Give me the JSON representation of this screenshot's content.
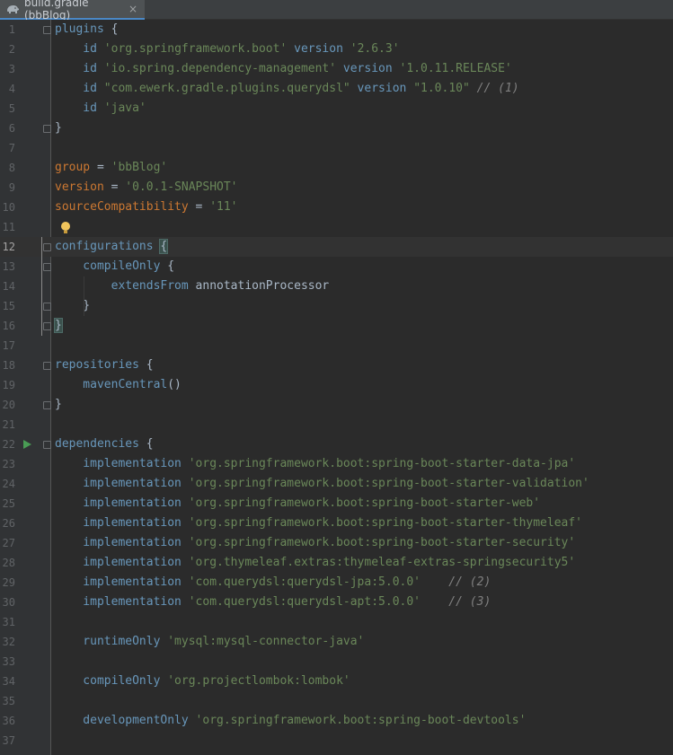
{
  "tab": {
    "title": "build.gradle (bbBlog)",
    "close_glyph": "×",
    "icon": "gradle-elephant-icon"
  },
  "editor": {
    "current_line": 12,
    "lines": [
      {
        "n": "1",
        "tokens": [
          {
            "t": "plugins",
            "c": "meth"
          },
          {
            "t": " {",
            "c": "plain"
          }
        ]
      },
      {
        "n": "2",
        "tokens": [
          {
            "t": "    id ",
            "c": "meth"
          },
          {
            "t": "'org.springframework.boot'",
            "c": "str"
          },
          {
            "t": " version ",
            "c": "meth"
          },
          {
            "t": "'2.6.3'",
            "c": "str"
          }
        ]
      },
      {
        "n": "3",
        "tokens": [
          {
            "t": "    id ",
            "c": "meth"
          },
          {
            "t": "'io.spring.dependency-management'",
            "c": "str"
          },
          {
            "t": " version ",
            "c": "meth"
          },
          {
            "t": "'1.0.11.RELEASE'",
            "c": "str"
          }
        ]
      },
      {
        "n": "4",
        "tokens": [
          {
            "t": "    id ",
            "c": "meth"
          },
          {
            "t": "\"com.ewerk.gradle.plugins.querydsl\"",
            "c": "str"
          },
          {
            "t": " version ",
            "c": "meth"
          },
          {
            "t": "\"1.0.10\"",
            "c": "str"
          },
          {
            "t": " // (1)",
            "c": "cmt"
          }
        ]
      },
      {
        "n": "5",
        "tokens": [
          {
            "t": "    id ",
            "c": "meth"
          },
          {
            "t": "'java'",
            "c": "str"
          }
        ]
      },
      {
        "n": "6",
        "tokens": [
          {
            "t": "}",
            "c": "plain"
          }
        ]
      },
      {
        "n": "7",
        "tokens": []
      },
      {
        "n": "8",
        "tokens": [
          {
            "t": "group",
            "c": "kw"
          },
          {
            "t": " = ",
            "c": "plain"
          },
          {
            "t": "'bbBlog'",
            "c": "str"
          }
        ]
      },
      {
        "n": "9",
        "tokens": [
          {
            "t": "version",
            "c": "kw"
          },
          {
            "t": " = ",
            "c": "plain"
          },
          {
            "t": "'0.0.1-SNAPSHOT'",
            "c": "str"
          }
        ]
      },
      {
        "n": "10",
        "tokens": [
          {
            "t": "sourceCompatibility",
            "c": "kw"
          },
          {
            "t": " = ",
            "c": "plain"
          },
          {
            "t": "'11'",
            "c": "str"
          }
        ]
      },
      {
        "n": "11",
        "tokens": []
      },
      {
        "n": "12",
        "tokens": [
          {
            "t": "configurations",
            "c": "meth"
          },
          {
            "t": " ",
            "c": "plain"
          },
          {
            "t": "{",
            "c": "brace"
          }
        ]
      },
      {
        "n": "13",
        "tokens": [
          {
            "t": "    compileOnly",
            "c": "meth"
          },
          {
            "t": " {",
            "c": "plain"
          }
        ]
      },
      {
        "n": "14",
        "tokens": [
          {
            "t": "        extendsFrom",
            "c": "meth"
          },
          {
            "t": " annotationProcessor",
            "c": "plain"
          }
        ]
      },
      {
        "n": "15",
        "tokens": [
          {
            "t": "    }",
            "c": "plain"
          }
        ]
      },
      {
        "n": "16",
        "tokens": [
          {
            "t": "}",
            "c": "brace"
          }
        ]
      },
      {
        "n": "17",
        "tokens": []
      },
      {
        "n": "18",
        "tokens": [
          {
            "t": "repositories",
            "c": "meth"
          },
          {
            "t": " {",
            "c": "plain"
          }
        ]
      },
      {
        "n": "19",
        "tokens": [
          {
            "t": "    mavenCentral",
            "c": "meth"
          },
          {
            "t": "()",
            "c": "plain"
          }
        ]
      },
      {
        "n": "20",
        "tokens": [
          {
            "t": "}",
            "c": "plain"
          }
        ]
      },
      {
        "n": "21",
        "tokens": []
      },
      {
        "n": "22",
        "tokens": [
          {
            "t": "dependencies",
            "c": "meth"
          },
          {
            "t": " {",
            "c": "plain"
          }
        ]
      },
      {
        "n": "23",
        "tokens": [
          {
            "t": "    implementation ",
            "c": "meth"
          },
          {
            "t": "'org.springframework.boot:spring-boot-starter-data-jpa'",
            "c": "str"
          }
        ]
      },
      {
        "n": "24",
        "tokens": [
          {
            "t": "    implementation ",
            "c": "meth"
          },
          {
            "t": "'org.springframework.boot:spring-boot-starter-validation'",
            "c": "str"
          }
        ]
      },
      {
        "n": "25",
        "tokens": [
          {
            "t": "    implementation ",
            "c": "meth"
          },
          {
            "t": "'org.springframework.boot:spring-boot-starter-web'",
            "c": "str"
          }
        ]
      },
      {
        "n": "26",
        "tokens": [
          {
            "t": "    implementation ",
            "c": "meth"
          },
          {
            "t": "'org.springframework.boot:spring-boot-starter-thymeleaf'",
            "c": "str"
          }
        ]
      },
      {
        "n": "27",
        "tokens": [
          {
            "t": "    implementation ",
            "c": "meth"
          },
          {
            "t": "'org.springframework.boot:spring-boot-starter-security'",
            "c": "str"
          }
        ]
      },
      {
        "n": "28",
        "tokens": [
          {
            "t": "    implementation ",
            "c": "meth"
          },
          {
            "t": "'org.thymeleaf.extras:thymeleaf-extras-springsecurity5'",
            "c": "str"
          }
        ]
      },
      {
        "n": "29",
        "tokens": [
          {
            "t": "    implementation ",
            "c": "meth"
          },
          {
            "t": "'com.querydsl:querydsl-jpa:5.0.0'",
            "c": "str"
          },
          {
            "t": "    // (2)",
            "c": "cmt"
          }
        ]
      },
      {
        "n": "30",
        "tokens": [
          {
            "t": "    implementation ",
            "c": "meth"
          },
          {
            "t": "'com.querydsl:querydsl-apt:5.0.0'",
            "c": "str"
          },
          {
            "t": "    // (3)",
            "c": "cmt"
          }
        ]
      },
      {
        "n": "31",
        "tokens": []
      },
      {
        "n": "32",
        "tokens": [
          {
            "t": "    runtimeOnly ",
            "c": "meth"
          },
          {
            "t": "'mysql:mysql-connector-java'",
            "c": "str"
          }
        ]
      },
      {
        "n": "33",
        "tokens": []
      },
      {
        "n": "34",
        "tokens": [
          {
            "t": "    compileOnly ",
            "c": "meth"
          },
          {
            "t": "'org.projectlombok:lombok'",
            "c": "str"
          }
        ]
      },
      {
        "n": "35",
        "tokens": []
      },
      {
        "n": "36",
        "tokens": [
          {
            "t": "    developmentOnly ",
            "c": "meth"
          },
          {
            "t": "'org.springframework.boot:spring-boot-devtools'",
            "c": "str"
          }
        ]
      },
      {
        "n": "37",
        "tokens": []
      }
    ]
  }
}
